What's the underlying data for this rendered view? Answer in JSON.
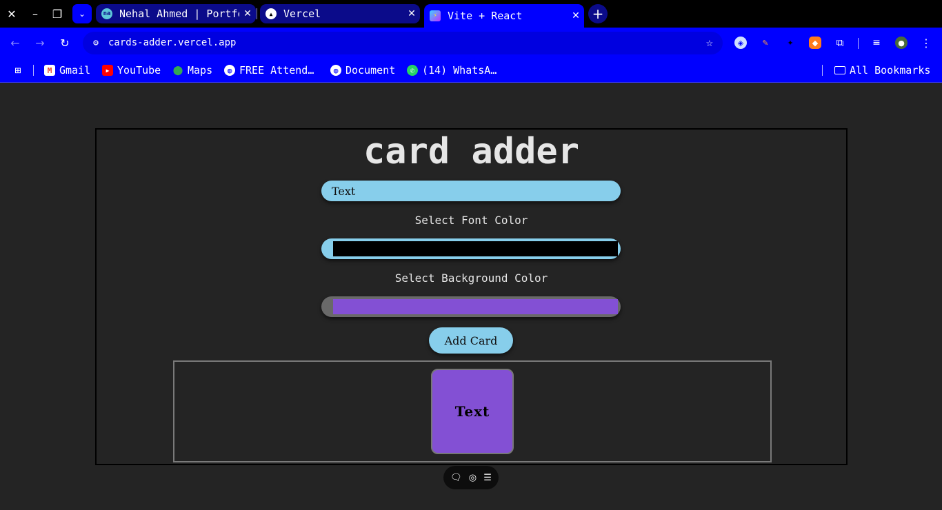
{
  "browser": {
    "tabs": [
      {
        "title": "Nehal Ahmed | Portfolio",
        "favicon": "na-logo-icon",
        "active": false
      },
      {
        "title": "Vercel",
        "favicon": "vercel-triangle-icon",
        "active": false
      },
      {
        "title": "Vite + React",
        "favicon": "vite-logo-icon",
        "active": true
      }
    ],
    "address_bar": {
      "url": "cards-adder.vercel.app"
    },
    "bookmarks": [
      {
        "label": "Gmail",
        "icon": "gmail-icon"
      },
      {
        "label": "YouTube",
        "icon": "youtube-icon"
      },
      {
        "label": "Maps",
        "icon": "maps-icon"
      },
      {
        "label": "FREE Attend…",
        "icon": "globe-icon"
      },
      {
        "label": "Document",
        "icon": "globe-icon"
      },
      {
        "label": "(14) WhatsA…",
        "icon": "whatsapp-icon"
      }
    ],
    "all_bookmarks_label": "All Bookmarks",
    "colors": {
      "chrome_bg": "#0000ff",
      "titlebar_bg": "#000000",
      "inactive_tab_bg": "#0b0b8a"
    }
  },
  "app": {
    "title": "card adder",
    "text_input_value": "Text",
    "font_color_label": "Select Font Color",
    "font_color_value": "#000000",
    "background_color_label": "Select Background Color",
    "background_color_value": "#8350d4",
    "add_button_label": "Add Card",
    "cards": [
      {
        "text": "Text",
        "font_color": "#000000",
        "background_color": "#8350d4"
      }
    ],
    "colors": {
      "page_bg": "#242424",
      "input_bg": "#87ceeb",
      "title_color": "#e6e6e6"
    }
  },
  "devbar": {
    "icons": [
      "comment-icon",
      "eye-toggle-icon",
      "menu-lines-icon"
    ]
  }
}
